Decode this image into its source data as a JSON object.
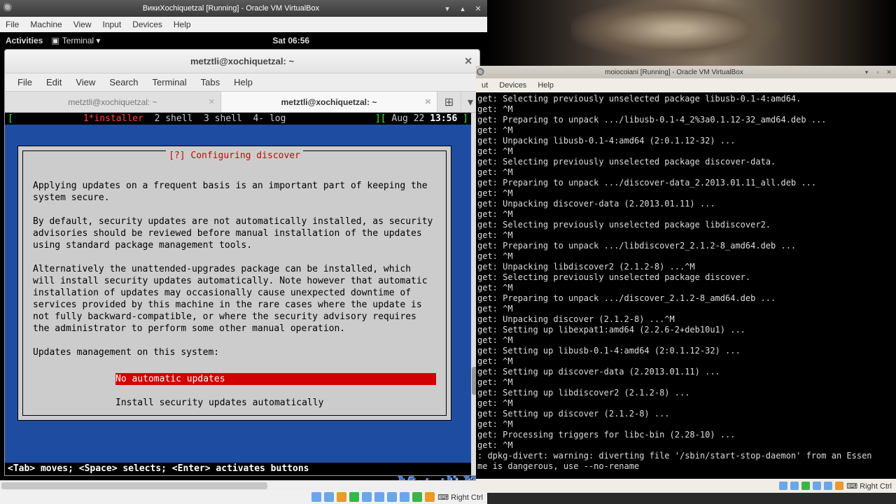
{
  "left_vbox": {
    "title": "ВикиXochiquetzal [Running] - Oracle VM VirtualBox",
    "menubar": [
      "File",
      "Machine",
      "View",
      "Input",
      "Devices",
      "Help"
    ],
    "statusbar_hostkey": "Right Ctrl"
  },
  "gnome": {
    "activities": "Activities",
    "app_label": "Terminal ▾",
    "clock": "Sat 06:56"
  },
  "gterm": {
    "title": "metztli@xochiquetzal: ~",
    "menubar": [
      "File",
      "Edit",
      "View",
      "Search",
      "Terminal",
      "Tabs",
      "Help"
    ],
    "tabs": [
      {
        "label": "metztli@xochiquetzal: ~",
        "active": false
      },
      {
        "label": "metztli@xochiquetzal: ~",
        "active": true
      }
    ]
  },
  "screen_status": {
    "left_bracket": "[",
    "window1": "1*installer",
    "window2": "2 shell",
    "window3": "3 shell",
    "window4": "4- log",
    "right_bracket": "][",
    "date": "Aug 22",
    "time": "13:56",
    "end_bracket": "]"
  },
  "installer": {
    "frame_title": "[?] Configuring discover",
    "para1": "Applying updates on a frequent basis is an important part of keeping the system secure.",
    "para2": "By default, security updates are not automatically installed, as security advisories should be reviewed before manual installation of the updates using standard package management tools.",
    "para3": "Alternatively the unattended-upgrades package can be installed, which will install security updates automatically. Note however that automatic installation of updates may occasionally cause unexpected downtime of services provided by this machine in the rare cases where the update is not fully backward-compatible, or where the security advisory requires the administrator to perform some other manual operation.",
    "prompt": "Updates management on this system:",
    "options": [
      {
        "label": "No automatic updates",
        "selected": true
      },
      {
        "label": "Install security updates automatically",
        "selected": false
      }
    ],
    "hint": "<Tab> moves; <Space> selects; <Enter> activates buttons"
  },
  "watermark": "Metztli IT",
  "right_vbox": {
    "title": "moiocoiani [Running] - Oracle VM VirtualBox",
    "menubar_visible": [
      "ut",
      "Devices",
      "Help"
    ],
    "statusbar_hostkey": "Right Ctrl",
    "log_lines": [
      "get: Selecting previously unselected package libusb-0.1-4:amd64.",
      "get: ^M",
      "get: Preparing to unpack .../libusb-0.1-4_2%3a0.1.12-32_amd64.deb ...",
      "get: ^M",
      "get: Unpacking libusb-0.1-4:amd64 (2:0.1.12-32) ...",
      "get: ^M",
      "get: Selecting previously unselected package discover-data.",
      "get: ^M",
      "get: Preparing to unpack .../discover-data_2.2013.01.11_all.deb ...",
      "get: ^M",
      "get: Unpacking discover-data (2.2013.01.11) ...",
      "get: ^M",
      "get: Selecting previously unselected package libdiscover2.",
      "get: ^M",
      "get: Preparing to unpack .../libdiscover2_2.1.2-8_amd64.deb ...",
      "get: ^M",
      "get: Unpacking libdiscover2 (2.1.2-8) ...^M",
      "get: Selecting previously unselected package discover.",
      "get: ^M",
      "get: Preparing to unpack .../discover_2.1.2-8_amd64.deb ...",
      "get: ^M",
      "get: Unpacking discover (2.1.2-8) ...^M",
      "get: Setting up libexpat1:amd64 (2.2.6-2+deb10u1) ...",
      "get: ^M",
      "get: Setting up libusb-0.1-4:amd64 (2:0.1.12-32) ...",
      "get: ^M",
      "get: Setting up discover-data (2.2013.01.11) ...",
      "get: ^M",
      "get: Setting up libdiscover2 (2.1.2-8) ...",
      "get: ^M",
      "get: Setting up discover (2.1.2-8) ...",
      "get: ^M",
      "get: Processing triggers for libc-bin (2.28-10) ...",
      "get: ^M",
      ": dpkg-divert: warning: diverting file '/sbin/start-stop-daemon' from an Essen",
      "me is dangerous, use --no-rename"
    ]
  }
}
